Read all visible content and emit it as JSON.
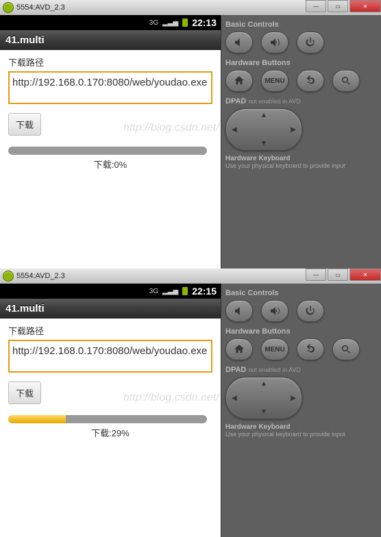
{
  "screenshots": [
    {
      "window_title": "5554:AVD_2.3",
      "clock": "22:13",
      "app_title": "41.multi",
      "path_label": "下载路径",
      "url_value": "http://192.168.0.170:8080/web/youdao.exe",
      "download_button": "下载",
      "progress_text": "下载:0%",
      "progress_pct": 0
    },
    {
      "window_title": "5554:AVD_2.3",
      "clock": "22:15",
      "app_title": "41.multi",
      "path_label": "下载路径",
      "url_value": "http://192.168.0.170:8080/web/youdao.exe",
      "download_button": "下载",
      "progress_text": "下载:29%",
      "progress_pct": 29
    }
  ],
  "side": {
    "basic_title": "Basic Controls",
    "hardware_title": "Hardware Buttons",
    "menu_label": "MENU",
    "dpad_label": "DPAD",
    "dpad_note": "not enabled in AVD",
    "kbd_title": "Hardware Keyboard",
    "kbd_sub": "Use your physical keyboard to provide input"
  },
  "watermark": "http://blog.csdn.net/"
}
